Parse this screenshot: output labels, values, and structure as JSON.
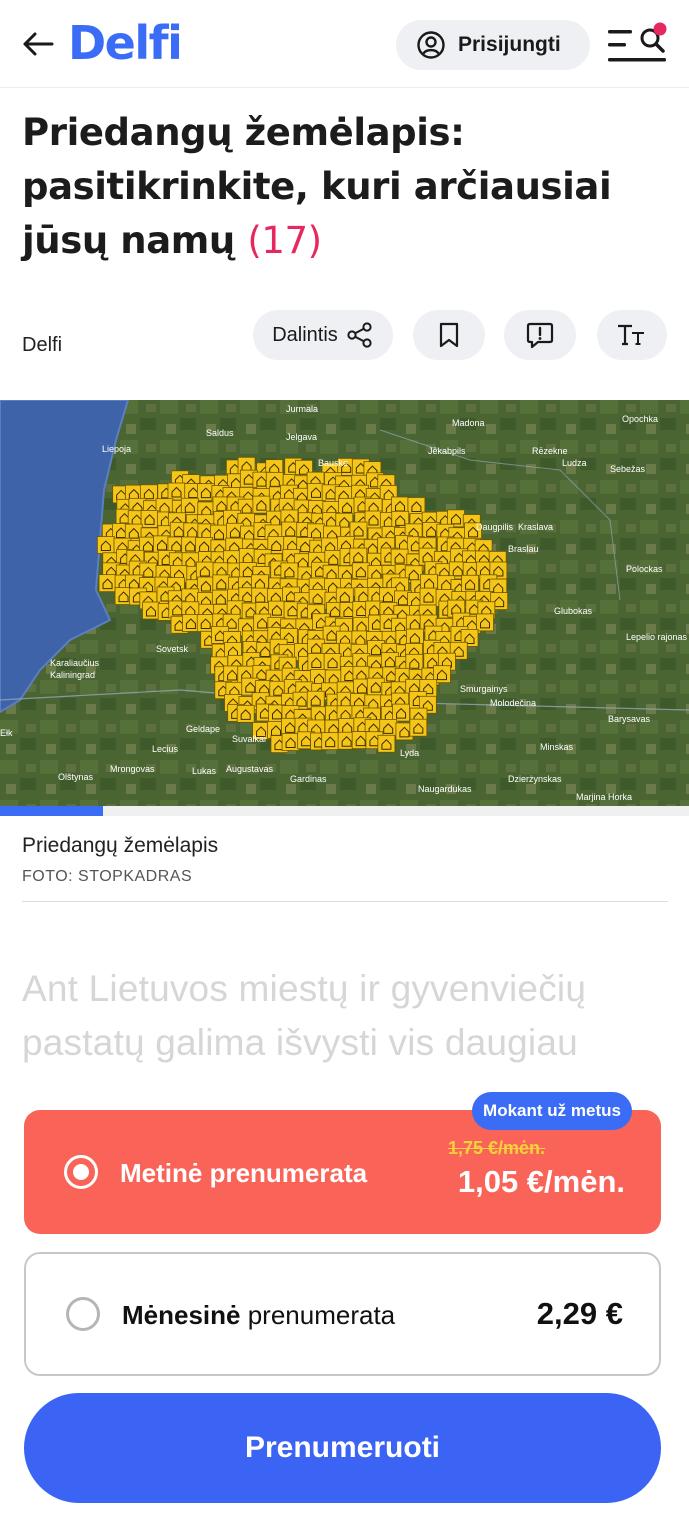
{
  "header": {
    "logo": "Delfi",
    "login_label": "Prisijungti"
  },
  "article": {
    "title": "Priedangų žemėlapis: pasitikrinkite, kuri arčiausiai jūsų namų",
    "comment_count": "(17)",
    "author": "Delfi",
    "share_label": "Dalintis",
    "lead": "Ant Lietuvos miestų ir gyvenviečių pastatų galima išvysti vis daugiau"
  },
  "map": {
    "caption": "Priedangų žemėlapis",
    "credit": "FOTO: STOPKADRAS",
    "gallery_progress": 0.15,
    "labels": [
      "Jurmala",
      "Saldus",
      "Jelgava",
      "Madona",
      "Opochka",
      "Liepoja",
      "Bauske",
      "Jēkabpils",
      "Rēzekne",
      "Ludza",
      "Sebežas",
      "Daugpilis",
      "Kraslava",
      "Braslau",
      "Polockas",
      "Karaliaučius",
      "Kaliningrad",
      "Sovetsk",
      "Glubokas",
      "Lepelio rajonas",
      "Smurgainys",
      "Molodečina",
      "Geldape",
      "Suvalkai",
      "Barysavas",
      "Ełk",
      "Lecius",
      "Mrongovas",
      "Lukas",
      "Augustavas",
      "Gardinas",
      "Lyda",
      "Minskas",
      "Olštynas",
      "Naugardukas",
      "Dzierżynskas",
      "Marjina Horka"
    ]
  },
  "subscription": {
    "badge": "Mokant už metus",
    "yearly_label": "Metinė prenumerata",
    "yearly_old_price": "1,75 €/mėn.",
    "yearly_price": "1,05 €/mėn.",
    "monthly_label_bold": "Mėnesinė",
    "monthly_label_rest": " prenumerata",
    "monthly_price": "2,29 €",
    "subscribe_button": "Prenumeruoti",
    "selected": "yearly"
  },
  "colors": {
    "brand": "#3b6cf6",
    "accent": "#e5285f",
    "plan_selected": "#fa6458"
  }
}
